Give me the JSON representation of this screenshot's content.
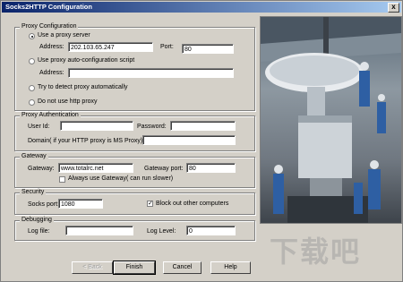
{
  "window": {
    "title": "Socks2HTTP Configuration",
    "close_glyph": "x"
  },
  "proxy_config": {
    "group_title": "Proxy Configuration",
    "use_proxy_label": "Use a proxy server",
    "address_label": "Address:",
    "address_value": "202.103.65.247",
    "port_label": "Port:",
    "port_value": "80",
    "auto_script_label": "Use proxy auto-configuration script",
    "auto_address_label": "Address:",
    "auto_address_value": "",
    "detect_label": "Try to detect proxy automatically",
    "no_proxy_label": "Do not use http proxy"
  },
  "proxy_auth": {
    "group_title": "Proxy Authentication",
    "userid_label": "User Id:",
    "userid_value": "",
    "password_label": "Password:",
    "password_value": "",
    "domain_label": "Domain( if your HTTP proxy is MS Proxy):",
    "domain_value": ""
  },
  "gateway": {
    "group_title": "Gateway",
    "gateway_label": "Gateway:",
    "gateway_value": "www.totalrc.net",
    "gateway_port_label": "Gateway port:",
    "gateway_port_value": "80",
    "always_use_label": "Always use Gateway( can run slower)"
  },
  "security": {
    "group_title": "Security",
    "socks_port_label": "Socks port:",
    "socks_port_value": "1080",
    "block_label": "Block out other computers",
    "block_check": "✓"
  },
  "debugging": {
    "group_title": "Debugging",
    "logfile_label": "Log file:",
    "logfile_value": "",
    "loglevel_label": "Log Level:",
    "loglevel_value": "0"
  },
  "buttons": {
    "back": "< Back",
    "finish": "Finish",
    "cancel": "Cancel",
    "help": "Help"
  },
  "watermark": "下载吧"
}
